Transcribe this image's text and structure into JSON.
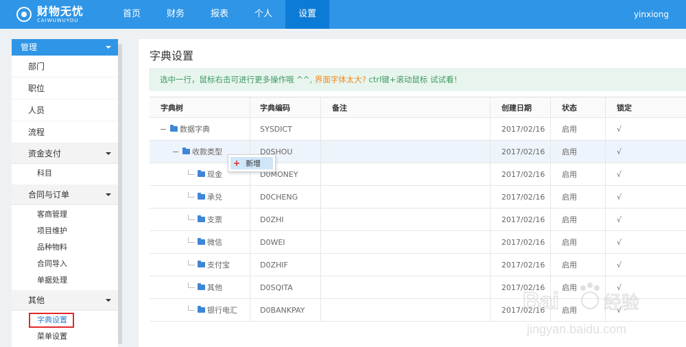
{
  "brand": {
    "name_cn": "财物无忧",
    "name_en": "CAIWUWUYOU"
  },
  "nav": [
    {
      "label": "首页",
      "active": false
    },
    {
      "label": "财务",
      "active": false
    },
    {
      "label": "报表",
      "active": false
    },
    {
      "label": "个人",
      "active": false
    },
    {
      "label": "设置",
      "active": true
    }
  ],
  "user": {
    "name": "yinxiong"
  },
  "sidebar": {
    "header": "管理",
    "items": [
      "部门",
      "职位",
      "人员",
      "流程"
    ],
    "groups": [
      {
        "label": "资金支付",
        "items": [
          "科目"
        ]
      },
      {
        "label": "合同与订单",
        "items": [
          "客商管理",
          "项目维护",
          "品种物料",
          "合同导入",
          "单据处理"
        ]
      },
      {
        "label": "其他",
        "items": [
          "字典设置",
          "菜单设置"
        ],
        "selected": "字典设置"
      }
    ]
  },
  "page": {
    "title": "字典设置",
    "tip_prefix": "选中一行，鼠标右击可进行更多操作哦 ^^,",
    "tip_warn": "界面字体太大?",
    "tip_suffix": "ctrl键+滚动鼠标 试试看！"
  },
  "table": {
    "columns": [
      "字典树",
      "字典编码",
      "备注",
      "创建日期",
      "状态",
      "锁定"
    ],
    "rows": [
      {
        "name": "数据字典",
        "code": "SYSDICT",
        "note": "",
        "date": "2017/02/16",
        "status": "启用",
        "locked": "√",
        "level": 0
      },
      {
        "name": "收款类型",
        "code": "D0SHOU",
        "note": "",
        "date": "2017/02/16",
        "status": "启用",
        "locked": "√",
        "level": 1
      },
      {
        "name": "现金",
        "code": "D0MONEY",
        "note": "",
        "date": "2017/02/16",
        "status": "启用",
        "locked": "√",
        "level": 2
      },
      {
        "name": "承兑",
        "code": "D0CHENG",
        "note": "",
        "date": "2017/02/16",
        "status": "启用",
        "locked": "√",
        "level": 2
      },
      {
        "name": "支票",
        "code": "D0ZHI",
        "note": "",
        "date": "2017/02/16",
        "status": "启用",
        "locked": "√",
        "level": 2
      },
      {
        "name": "微信",
        "code": "D0WEI",
        "note": "",
        "date": "2017/02/16",
        "status": "启用",
        "locked": "√",
        "level": 2
      },
      {
        "name": "支付宝",
        "code": "D0ZHIF",
        "note": "",
        "date": "2017/02/16",
        "status": "启用",
        "locked": "√",
        "level": 2
      },
      {
        "name": "其他",
        "code": "D0SQITA",
        "note": "",
        "date": "2017/02/16",
        "status": "启用",
        "locked": "√",
        "level": 2
      },
      {
        "name": "银行电汇",
        "code": "D0BANKPAY",
        "note": "",
        "date": "2017/02/16",
        "status": "启用",
        "locked": "√",
        "level": 2
      }
    ]
  },
  "context_menu": {
    "add_label": "新增"
  },
  "watermark": {
    "brand": "Bai",
    "brand_cn": "经验",
    "url": "jingyan.baidu.com"
  },
  "colors": {
    "primary": "#2f95e6",
    "nav_active": "#0c7bd6",
    "tip_bg": "#e8f5ee",
    "tip_text": "#3f9a63",
    "warn": "#f08a1f",
    "selected_border": "#e02828"
  }
}
